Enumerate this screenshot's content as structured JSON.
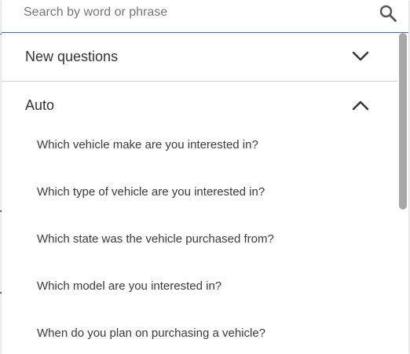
{
  "search": {
    "placeholder": "Search by word or phrase",
    "value": "",
    "icon": "search-icon"
  },
  "sections": [
    {
      "title": "New questions",
      "expanded": false,
      "icon": "chevron-down-icon"
    },
    {
      "title": "Auto",
      "expanded": true,
      "icon": "chevron-up-icon",
      "questions": [
        "Which vehicle make are you interested in?",
        "Which type of vehicle are you interested in?",
        "Which state was the vehicle purchased from?",
        "Which model are you interested in?",
        "When do you plan on purchasing a vehicle?"
      ]
    }
  ],
  "colors": {
    "focus_border": "#2f6fd6",
    "text": "#333333",
    "placeholder": "#757575",
    "divider": "#cfcfcf",
    "scroll_thumb": "#a8a8a8"
  }
}
